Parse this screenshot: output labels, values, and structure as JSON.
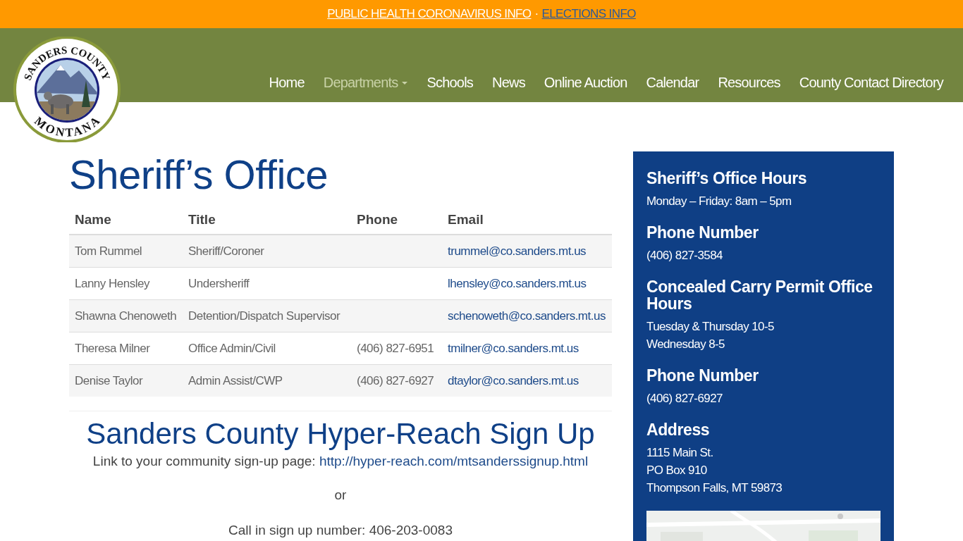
{
  "alert_bar": {
    "links": [
      {
        "label": "PUBLIC HEALTH CORONAVIRUS INFO",
        "kind": "light"
      },
      {
        "label": "ELECTIONS INFO",
        "kind": "dark"
      }
    ],
    "separator": "·"
  },
  "logo": {
    "top_text": "SANDERS COUNTY",
    "bottom_text": "MONTANA"
  },
  "nav": {
    "items": [
      {
        "label": "Home",
        "selected": false,
        "dropdown": false
      },
      {
        "label": "Departments",
        "selected": true,
        "dropdown": true
      },
      {
        "label": "Schools",
        "selected": false,
        "dropdown": false
      },
      {
        "label": "News",
        "selected": false,
        "dropdown": false
      },
      {
        "label": "Online Auction",
        "selected": false,
        "dropdown": false
      },
      {
        "label": "Calendar",
        "selected": false,
        "dropdown": false
      },
      {
        "label": "Resources",
        "selected": false,
        "dropdown": false
      },
      {
        "label": "County Contact Directory",
        "selected": false,
        "dropdown": false
      }
    ]
  },
  "page_title": "Sheriff’s Office",
  "table": {
    "columns": [
      "Name",
      "Title",
      "Phone",
      "Email"
    ],
    "rows": [
      [
        "Tom Rummel",
        "Sheriff/Coroner",
        "",
        "trummel@co.sanders.mt.us"
      ],
      [
        "Lanny Hensley",
        "Undersheriff",
        "",
        "lhensley@co.sanders.mt.us"
      ],
      [
        "Shawna Chenoweth",
        "Detention/Dispatch Supervisor",
        "",
        "schenoweth@co.sanders.mt.us"
      ],
      [
        "Theresa Milner",
        "Office Admin/Civil",
        "(406) 827-6951",
        "tmilner@co.sanders.mt.us"
      ],
      [
        "Denise Taylor",
        "Admin Assist/CWP",
        "(406) 827-6927",
        "dtaylor@co.sanders.mt.us"
      ]
    ]
  },
  "signup": {
    "title": "Sanders County Hyper-Reach Sign Up",
    "link_intro": "Link to your community sign-up page:",
    "link": "http://hyper-reach.com/mtsanderssignup.html",
    "or": "or",
    "call": "Call in sign up number: 406-203-0083"
  },
  "sidebar": {
    "sections": [
      {
        "heading": "Sheriff’s Office Hours",
        "lines": [
          "Monday – Friday: 8am – 5pm"
        ]
      },
      {
        "heading": "Phone Number",
        "lines": [
          "(406) 827-3584"
        ]
      },
      {
        "heading": "Concealed Carry Permit Office Hours",
        "lines": [
          "Tuesday & Thursday 10-5",
          "Wednesday 8-5"
        ]
      },
      {
        "heading": "Phone Number",
        "lines": [
          "(406) 827-6927"
        ]
      },
      {
        "heading": "Address",
        "lines": [
          "1115 Main St.",
          "PO Box 910",
          "Thompson Falls, MT 59873"
        ]
      }
    ]
  }
}
